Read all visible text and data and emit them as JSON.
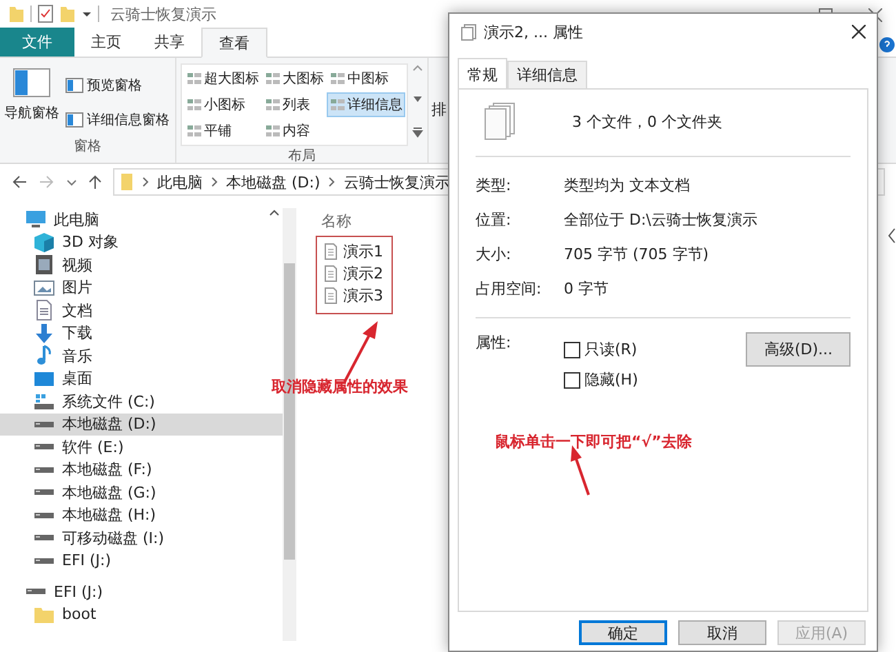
{
  "explorer": {
    "title": "云骑士恢复演示",
    "tabs": [
      {
        "label": "文件",
        "kind": "file",
        "selected": false
      },
      {
        "label": "主页",
        "kind": "tab",
        "selected": false
      },
      {
        "label": "共享",
        "kind": "tab",
        "selected": false
      },
      {
        "label": "查看",
        "kind": "tab",
        "selected": true
      }
    ],
    "ribbon": {
      "panes": {
        "title": "窗格",
        "nav_pane": "导航窗格",
        "items": [
          "预览窗格",
          "详细信息窗格"
        ]
      },
      "layout": {
        "title": "布局",
        "options": [
          {
            "label": "超大图标",
            "selected": false
          },
          {
            "label": "大图标",
            "selected": false
          },
          {
            "label": "中图标",
            "selected": false
          },
          {
            "label": "小图标",
            "selected": false
          },
          {
            "label": "列表",
            "selected": false
          },
          {
            "label": "详细信息",
            "selected": true
          },
          {
            "label": "平铺",
            "selected": false
          },
          {
            "label": "内容",
            "selected": false
          }
        ]
      },
      "cut_group": "排"
    },
    "breadcrumbs": [
      "此电脑",
      "本地磁盘 (D:)",
      "云骑士恢复演示"
    ],
    "nav_tree": [
      {
        "label": "此电脑",
        "kind": "pc",
        "selected": false,
        "children": [
          {
            "label": "3D 对象",
            "kind": "cube",
            "selected": false
          },
          {
            "label": "视频",
            "kind": "video",
            "selected": false
          },
          {
            "label": "图片",
            "kind": "picture",
            "selected": false
          },
          {
            "label": "文档",
            "kind": "doc",
            "selected": false
          },
          {
            "label": "下载",
            "kind": "download",
            "selected": false
          },
          {
            "label": "音乐",
            "kind": "music",
            "selected": false
          },
          {
            "label": "桌面",
            "kind": "desktop",
            "selected": false
          },
          {
            "label": "系统文件 (C:)",
            "kind": "sysdrive",
            "selected": false
          },
          {
            "label": "本地磁盘 (D:)",
            "kind": "drive",
            "selected": true
          },
          {
            "label": "软件 (E:)",
            "kind": "drive",
            "selected": false
          },
          {
            "label": "本地磁盘 (F:)",
            "kind": "drive",
            "selected": false
          },
          {
            "label": "本地磁盘 (G:)",
            "kind": "drive",
            "selected": false
          },
          {
            "label": "本地磁盘 (H:)",
            "kind": "drive",
            "selected": false
          },
          {
            "label": "可移动磁盘 (I:)",
            "kind": "drive",
            "selected": false
          },
          {
            "label": "EFI (J:)",
            "kind": "drive",
            "selected": false
          }
        ]
      },
      {
        "label": "EFI (J:)",
        "kind": "drive",
        "selected": false,
        "children": [
          {
            "label": "boot",
            "kind": "folder",
            "selected": false
          }
        ]
      }
    ],
    "column": "名称",
    "files": [
      "演示1",
      "演示2",
      "演示3"
    ],
    "annotation": "取消隐藏属性的效果"
  },
  "dialog": {
    "title": "演示2, ... 属性",
    "tabs": [
      {
        "label": "常规",
        "selected": true
      },
      {
        "label": "详细信息",
        "selected": false
      }
    ],
    "summary": "3 个文件，0 个文件夹",
    "properties": [
      {
        "label": "类型:",
        "value": "类型均为 文本文档"
      },
      {
        "label": "位置:",
        "value": "全部位于 D:\\云骑士恢复演示"
      },
      {
        "label": "大小:",
        "value": "705 字节 (705 字节)"
      },
      {
        "label": "占用空间:",
        "value": "0 字节"
      }
    ],
    "attributes_label": "属性:",
    "attributes": [
      {
        "label": "只读(R)",
        "checked": false
      },
      {
        "label": "隐藏(H)",
        "checked": false
      }
    ],
    "advanced_button": "高级(D)...",
    "annotation": "鼠标单击一下即可把“√”去除",
    "buttons": [
      {
        "label": "确定",
        "kind": "default",
        "disabled": false
      },
      {
        "label": "取消",
        "kind": "normal",
        "disabled": false
      },
      {
        "label": "应用(A)",
        "kind": "normal",
        "disabled": true
      }
    ]
  }
}
